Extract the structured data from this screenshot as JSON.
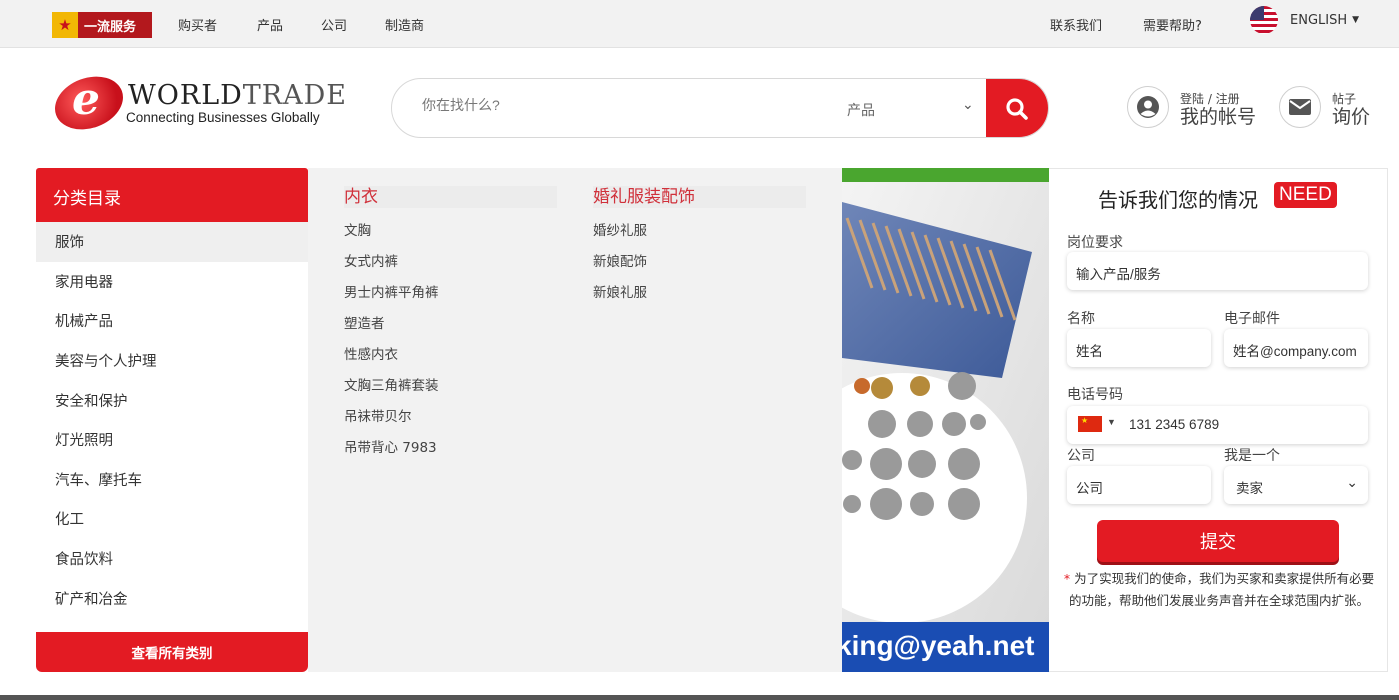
{
  "topbar": {
    "badge": "一流服务",
    "nav": [
      "购买者",
      "产品",
      "公司",
      "制造商"
    ],
    "contact": "联系我们",
    "help": "需要帮助?",
    "language": "ENGLISH"
  },
  "logo": {
    "brand_a": "WORLD",
    "brand_b": "TRADE",
    "tagline": "Connecting Businesses Globally"
  },
  "search": {
    "placeholder": "你在找什么?",
    "category": "产品"
  },
  "account": {
    "login": "登陆 / 注册",
    "label": "我的帐号"
  },
  "posts": {
    "small": "帖子",
    "label": "询价"
  },
  "sidebar": {
    "title": "分类目录",
    "items": [
      "服饰",
      "家用电器",
      "机械产品",
      "美容与个人护理",
      "安全和保护",
      "灯光照明",
      "汽车、摩托车",
      "化工",
      "食品饮料",
      "矿产和冶金"
    ],
    "view_all": "查看所有类别"
  },
  "mega": {
    "col1": {
      "title": "内衣",
      "links": [
        "文胸",
        "女式内裤",
        "男士内裤平角裤",
        "塑造者",
        "性感内衣",
        "文胸三角裤套装",
        "吊袜带贝尔",
        "吊带背心 7983"
      ]
    },
    "col2": {
      "title": "婚礼服装配饰",
      "links": [
        "婚纱礼服",
        "新娘配饰",
        "新娘礼服"
      ]
    }
  },
  "promo": {
    "email_fragment": "king@yeah.net"
  },
  "form": {
    "title": "告诉我们您的情况",
    "need": "NEED",
    "position_label": "岗位要求",
    "position_placeholder": "输入产品/服务",
    "name_label": "名称",
    "name_placeholder": "姓名",
    "email_label": "电子邮件",
    "email_placeholder": "姓名@company.com",
    "phone_label": "电话号码",
    "phone_placeholder": "131 2345 6789",
    "company_label": "公司",
    "company_placeholder": "公司",
    "role_label": "我是一个",
    "role_value": "卖家",
    "submit": "提交",
    "note": "为了实现我们的使命，我们为买家和卖家提供所有必要的功能，帮助他们发展业务声音并在全球范围内扩张。"
  },
  "colors": {
    "accent": "#e31b23",
    "badge": "#b3181d",
    "promo_green": "#4aa62f",
    "promo_blue": "#1a4db3"
  }
}
